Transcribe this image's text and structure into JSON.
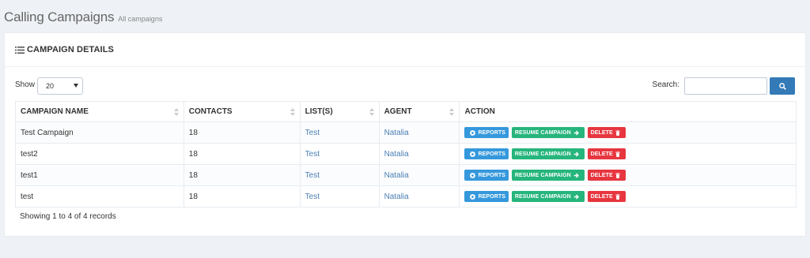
{
  "page": {
    "title": "Calling Campaigns",
    "subtitle": "All campaigns"
  },
  "portlet": {
    "caption": "CAMPAIGN DETAILS"
  },
  "controls": {
    "show_label": "Show",
    "show_value": "20",
    "search_label": "Search:",
    "search_value": ""
  },
  "table": {
    "headers": [
      "CAMPAIGN NAME",
      "CONTACTS",
      "LIST(S)",
      "AGENT",
      "ACTION"
    ],
    "rows": [
      {
        "name": "Test Campaign",
        "contacts": "18",
        "list": "Test",
        "agent": "Natalia"
      },
      {
        "name": "test2",
        "contacts": "18",
        "list": "Test",
        "agent": "Natalia"
      },
      {
        "name": "test1",
        "contacts": "18",
        "list": "Test",
        "agent": "Natalia"
      },
      {
        "name": "test",
        "contacts": "18",
        "list": "Test",
        "agent": "Natalia"
      }
    ],
    "actions": {
      "reports": "REPORTS",
      "resume": "RESUME CAMPAIGN",
      "delete": "DELETE"
    }
  },
  "footer": {
    "info": "Showing 1 to 4 of 4 records"
  },
  "colors": {
    "primary": "#337ab7",
    "reports": "#3598dc",
    "resume": "#26b57c",
    "delete": "#e7363f",
    "link": "#4a7fb5"
  },
  "icons": {
    "caption": "list-icon",
    "search": "search-icon",
    "reports": "cog-icon",
    "resume": "arrow-right-icon",
    "delete": "trash-icon",
    "sort": "sort-icon"
  }
}
